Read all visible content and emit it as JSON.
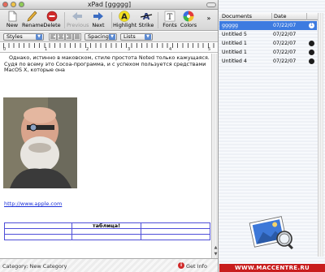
{
  "window": {
    "title": "xPad [ggggg]"
  },
  "toolbar": {
    "items": [
      {
        "label": "New",
        "icon": "new-document-icon",
        "enabled": true
      },
      {
        "label": "Rename",
        "icon": "pencil-icon",
        "enabled": true
      },
      {
        "label": "Delete",
        "icon": "delete-icon",
        "enabled": true
      },
      {
        "label": "Previous",
        "icon": "arrow-left-icon",
        "enabled": false
      },
      {
        "label": "Next",
        "icon": "arrow-right-icon",
        "enabled": true
      },
      {
        "label": "Highlight",
        "icon": "highlight-icon",
        "enabled": true,
        "glyph": "A"
      },
      {
        "label": "Strike",
        "icon": "strike-icon",
        "enabled": true,
        "glyph": "A"
      },
      {
        "label": "Fonts",
        "icon": "font-icon",
        "enabled": true,
        "glyph": "T"
      },
      {
        "label": "Colors",
        "icon": "color-wheel-icon",
        "enabled": true
      }
    ],
    "overflow": "»"
  },
  "formatbar": {
    "styles": "Styles",
    "spacing": "Spacing",
    "lists": "Lists"
  },
  "ruler": {
    "labels": [
      "0",
      "1",
      "2",
      "3",
      "4",
      "5"
    ]
  },
  "document": {
    "paragraph": "Однако, истинно в маковском, стиле простота Noted только кажущаяся. Судя по всему это Cocoa-программа, и с успехом пользуется средствами MacOS X, которые она",
    "link": "http://www.apple.com",
    "table_text": "таблица!"
  },
  "status": {
    "category": "Category: New Category",
    "info_label": "Get Info",
    "info_glyph": "i"
  },
  "drawer": {
    "columns": {
      "documents": "Documents",
      "date": "Date"
    },
    "rows": [
      {
        "name": "ggggg",
        "date": "07/22/07",
        "badge": "1",
        "selected": true
      },
      {
        "name": "Untitled 5",
        "date": "07/22/07",
        "badge": "",
        "selected": false
      },
      {
        "name": "Untitled 1",
        "date": "07/22/07",
        "badge": "",
        "selected": false
      },
      {
        "name": "Untitled 1",
        "date": "07/22/07",
        "badge": "",
        "selected": false
      },
      {
        "name": "Untitled 4",
        "date": "07/22/07",
        "badge": "",
        "selected": false
      }
    ]
  },
  "banner": {
    "text": "WWW.MACCENTRE.RU"
  },
  "colors": {
    "selection": "#3d7be0",
    "link": "#1a2fd8",
    "delete": "#d02a2a",
    "banner": "#c81d1d"
  }
}
